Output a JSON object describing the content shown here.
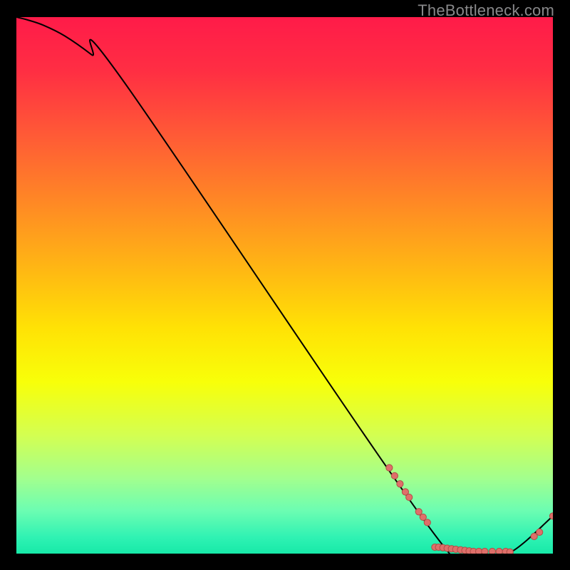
{
  "watermark": "TheBottleneck.com",
  "gradient_stops": [
    {
      "offset": 0.0,
      "color": "#ff1b49"
    },
    {
      "offset": 0.1,
      "color": "#ff2e43"
    },
    {
      "offset": 0.22,
      "color": "#ff5a36"
    },
    {
      "offset": 0.35,
      "color": "#ff8a24"
    },
    {
      "offset": 0.48,
      "color": "#ffbb12"
    },
    {
      "offset": 0.58,
      "color": "#ffe205"
    },
    {
      "offset": 0.68,
      "color": "#f8ff09"
    },
    {
      "offset": 0.78,
      "color": "#d3ff52"
    },
    {
      "offset": 0.86,
      "color": "#a2ff8e"
    },
    {
      "offset": 0.92,
      "color": "#6cfdb2"
    },
    {
      "offset": 0.97,
      "color": "#2ff2b3"
    },
    {
      "offset": 1.0,
      "color": "#17e9a8"
    }
  ],
  "curve_color": "#000000",
  "dot_fill": "#df6f6a",
  "dot_stroke": "#b04e46",
  "chart_data": {
    "type": "line",
    "title": "",
    "xlabel": "",
    "ylabel": "",
    "xlim": [
      0,
      100
    ],
    "ylim": [
      0,
      100
    ],
    "series": [
      {
        "name": "curve",
        "x": [
          0,
          2,
          5,
          9,
          14,
          20,
          78,
          86,
          92,
          100
        ],
        "y": [
          100,
          99.5,
          98.5,
          96.5,
          93,
          88,
          3.5,
          0.2,
          0.2,
          7
        ]
      }
    ],
    "markers": [
      {
        "x": 69.5,
        "y": 16.0
      },
      {
        "x": 70.5,
        "y": 14.5
      },
      {
        "x": 71.5,
        "y": 13.0
      },
      {
        "x": 72.5,
        "y": 11.5
      },
      {
        "x": 73.2,
        "y": 10.5
      },
      {
        "x": 75.0,
        "y": 7.8
      },
      {
        "x": 75.8,
        "y": 6.8
      },
      {
        "x": 76.6,
        "y": 5.8
      },
      {
        "x": 78.0,
        "y": 1.2
      },
      {
        "x": 78.7,
        "y": 1.2
      },
      {
        "x": 79.5,
        "y": 1.1
      },
      {
        "x": 80.3,
        "y": 1.0
      },
      {
        "x": 81.1,
        "y": 0.9
      },
      {
        "x": 81.9,
        "y": 0.8
      },
      {
        "x": 82.8,
        "y": 0.7
      },
      {
        "x": 83.6,
        "y": 0.6
      },
      {
        "x": 84.4,
        "y": 0.5
      },
      {
        "x": 85.2,
        "y": 0.4
      },
      {
        "x": 86.2,
        "y": 0.4
      },
      {
        "x": 87.3,
        "y": 0.4
      },
      {
        "x": 88.7,
        "y": 0.4
      },
      {
        "x": 90.0,
        "y": 0.4
      },
      {
        "x": 91.2,
        "y": 0.4
      },
      {
        "x": 92.0,
        "y": 0.3
      },
      {
        "x": 96.5,
        "y": 3.2
      },
      {
        "x": 97.5,
        "y": 4.0
      },
      {
        "x": 100.0,
        "y": 7.0
      }
    ]
  }
}
